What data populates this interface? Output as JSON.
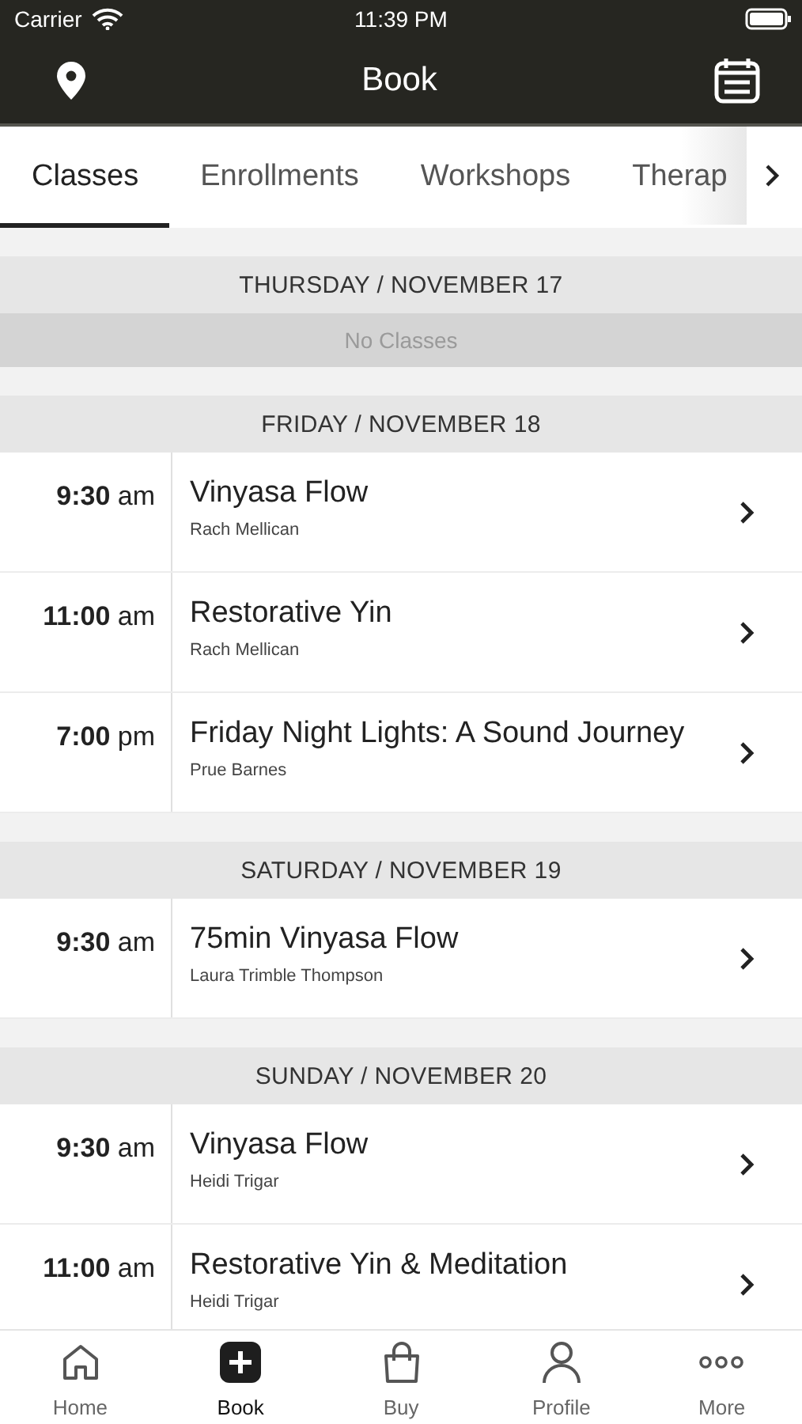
{
  "status_bar": {
    "carrier": "Carrier",
    "time": "11:39 PM"
  },
  "header": {
    "title": "Book"
  },
  "tabs": [
    {
      "label": "Classes",
      "selected": true
    },
    {
      "label": "Enrollments",
      "selected": false
    },
    {
      "label": "Workshops",
      "selected": false
    },
    {
      "label": "Therap",
      "selected": false
    }
  ],
  "days": [
    {
      "heading": "THURSDAY / NOVEMBER 17",
      "empty_text": "No Classes"
    },
    {
      "heading": "FRIDAY / NOVEMBER 18",
      "classes": [
        {
          "time": "**9:30** am",
          "name": "Vinyasa Flow",
          "teacher": "Rach Mellican"
        },
        {
          "time": "**11:00** am",
          "name": "Restorative Yin",
          "teacher": "Rach Mellican"
        },
        {
          "time": "**7:00** pm",
          "name": "Friday Night Lights: A Sound Journey",
          "teacher": "Prue Barnes"
        }
      ]
    },
    {
      "heading": "SATURDAY / NOVEMBER 19",
      "classes": [
        {
          "time": "**9:30** am",
          "name": "75min Vinyasa Flow",
          "teacher": "Laura Trimble Thompson"
        }
      ]
    },
    {
      "heading": "SUNDAY / NOVEMBER 20",
      "classes": [
        {
          "time": "**9:30** am",
          "name": "Vinyasa Flow",
          "teacher": "Heidi Trigar"
        },
        {
          "time": "**11:00** am",
          "name": "Restorative Yin & Meditation",
          "teacher": "Heidi Trigar"
        }
      ]
    }
  ],
  "nav": [
    {
      "kind": "home",
      "label": "Home",
      "selected": false
    },
    {
      "kind": "book",
      "label": "Book",
      "selected": true
    },
    {
      "kind": "buy",
      "label": "Buy",
      "selected": false
    },
    {
      "kind": "profile",
      "label": "Profile",
      "selected": false
    },
    {
      "kind": "more",
      "label": "More",
      "selected": false
    }
  ]
}
